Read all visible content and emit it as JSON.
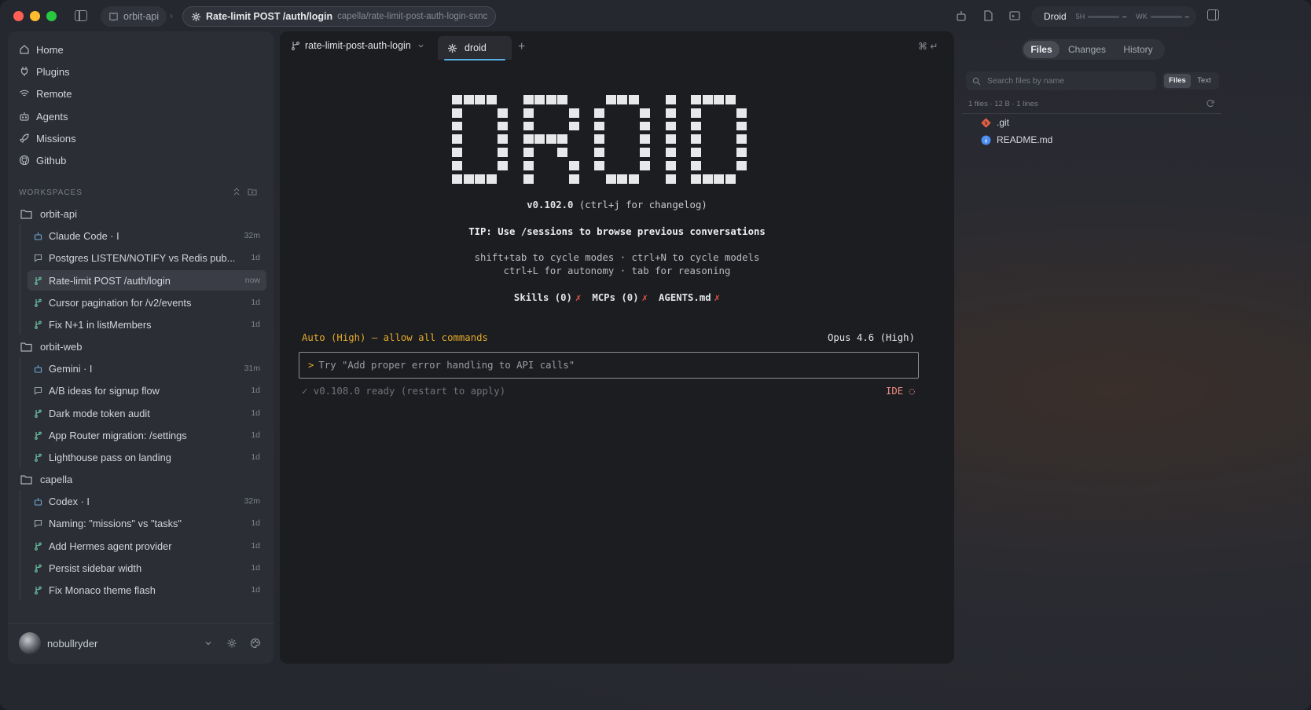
{
  "titlebar": {
    "project_crumb": "orbit-api",
    "session_title": "Rate-limit POST /auth/login",
    "session_path": "capella/rate-limit-post-auth-login-sxnc",
    "droid": {
      "label": "Droid",
      "meter_5h_label": "5H",
      "meter_5h_value": "–",
      "meter_wk_label": "WK",
      "meter_wk_value": "–",
      "status_color": "#6fa8ff"
    }
  },
  "sidebar": {
    "nav": [
      {
        "label": "Home",
        "icon": "home-icon"
      },
      {
        "label": "Plugins",
        "icon": "plug-icon"
      },
      {
        "label": "Remote",
        "icon": "wifi-icon"
      },
      {
        "label": "Agents",
        "icon": "robot-icon"
      },
      {
        "label": "Missions",
        "icon": "rocket-icon"
      },
      {
        "label": "Github",
        "icon": "github-icon"
      }
    ],
    "workspaces_header": "WORKSPACES",
    "workspaces": [
      {
        "name": "orbit-api",
        "sessions": [
          {
            "title": "Claude Code · I",
            "time": "32m",
            "icon": "robot-icon"
          },
          {
            "title": "Postgres LISTEN/NOTIFY vs Redis pub...",
            "time": "1d",
            "icon": "chat-icon"
          },
          {
            "title": "Rate-limit POST /auth/login",
            "time": "now",
            "icon": "branch-icon",
            "active": true
          },
          {
            "title": "Cursor pagination for /v2/events",
            "time": "1d",
            "icon": "branch-icon"
          },
          {
            "title": "Fix N+1 in listMembers",
            "time": "1d",
            "icon": "branch-icon"
          }
        ]
      },
      {
        "name": "orbit-web",
        "sessions": [
          {
            "title": "Gemini · I",
            "time": "31m",
            "icon": "robot-icon"
          },
          {
            "title": "A/B ideas for signup flow",
            "time": "1d",
            "icon": "chat-icon"
          },
          {
            "title": "Dark mode token audit",
            "time": "1d",
            "icon": "branch-icon"
          },
          {
            "title": "App Router migration: /settings",
            "time": "1d",
            "icon": "branch-icon"
          },
          {
            "title": "Lighthouse pass on landing",
            "time": "1d",
            "icon": "branch-icon"
          }
        ]
      },
      {
        "name": "capella",
        "sessions": [
          {
            "title": "Codex · I",
            "time": "32m",
            "icon": "robot-icon"
          },
          {
            "title": "Naming: \"missions\" vs \"tasks\"",
            "time": "1d",
            "icon": "chat-icon"
          },
          {
            "title": "Add Hermes agent provider",
            "time": "1d",
            "icon": "branch-icon"
          },
          {
            "title": "Persist sidebar width",
            "time": "1d",
            "icon": "branch-icon"
          },
          {
            "title": "Fix Monaco theme flash",
            "time": "1d",
            "icon": "branch-icon"
          }
        ]
      }
    ],
    "user": {
      "name": "nobullryder"
    }
  },
  "terminal": {
    "branch_tab": "rate-limit-post-auth-login",
    "active_tab": "droid",
    "shortcut_glyph": "⌘ ↵",
    "version_bold": "v0.102.0",
    "version_rest": " (ctrl+j for changelog)",
    "tip": "TIP: Use /sessions to browse previous conversations",
    "hint_line_1": "shift+tab to cycle modes · ctrl+N to cycle models",
    "hint_line_2": "ctrl+L for autonomy · tab for reasoning",
    "skills": "Skills (0)",
    "mcps": "MCPs (0)",
    "agents_md": "AGENTS.md",
    "missing_mark": "✗",
    "mode": "Auto (High) — allow all commands",
    "model": "Opus 4.6 (High)",
    "prompt_caret": ">",
    "prompt_placeholder": "Try \"Add proper error handling to API calls\"",
    "ready": "✓ v0.108.0 ready (restart to apply)",
    "ide": "IDE ◌"
  },
  "files_panel": {
    "tabs": [
      "Files",
      "Changes",
      "History"
    ],
    "active_tab": "Files",
    "search_placeholder": "Search files by name",
    "view_toggle": [
      "Files",
      "Text"
    ],
    "view_active": "Files",
    "meta": "1 files · 12 B · 1 lines",
    "files": [
      {
        "name": ".git",
        "icon": "git-icon",
        "color": "#e05d44"
      },
      {
        "name": "README.md",
        "icon": "info-icon",
        "color": "#4c8df0"
      }
    ]
  }
}
